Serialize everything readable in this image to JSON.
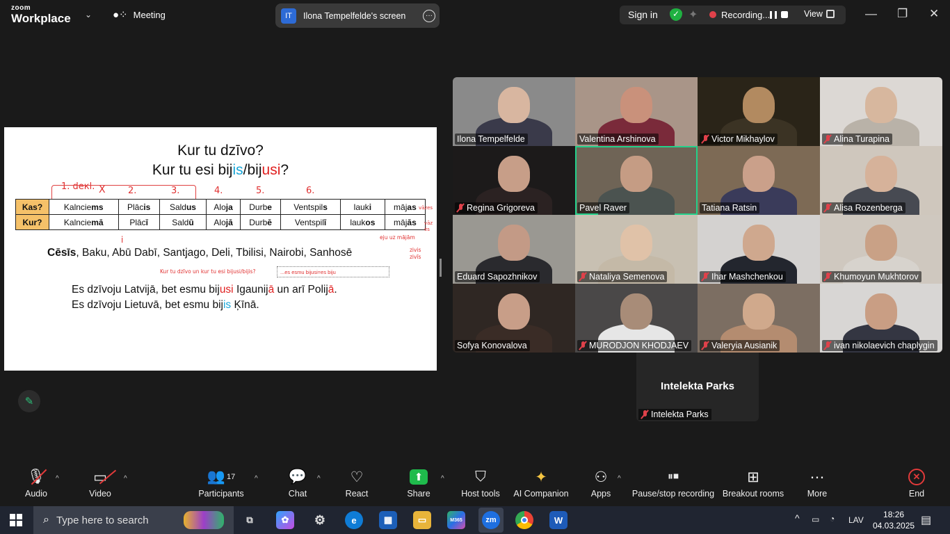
{
  "topbar": {
    "logo_small": "zoom",
    "logo_large": "Workplace",
    "meeting_label": "Meeting",
    "screen_badge": "IT",
    "screen_label": "Ilona Tempelfelde's screen",
    "sign_in": "Sign in",
    "recording_label": "Recording...",
    "view_label": "View"
  },
  "slide": {
    "title1": "Kur tu dzīvo?",
    "title2_a": "Kur tu esi bij",
    "title2_b": "is",
    "title2_c": "/bij",
    "title2_d": "usi",
    "title2_e": "?",
    "row1_head": "Kas?",
    "row2_head": "Kur?",
    "row1": [
      [
        "Kalncie",
        "ms"
      ],
      [
        "Plāc",
        "is"
      ],
      [
        "Sald",
        "us"
      ],
      [
        "Alo",
        "ja"
      ],
      [
        "Durb",
        "e"
      ],
      [
        "Ventspil",
        "s"
      ],
      [
        "lauk",
        "i"
      ],
      [
        "māj",
        "as"
      ]
    ],
    "row2": [
      [
        "Kalncie",
        "mā"
      ],
      [
        "Plāc",
        "ī"
      ],
      [
        "Sald",
        "ū"
      ],
      [
        "Alo",
        "jā"
      ],
      [
        "Durb",
        "ē"
      ],
      [
        "Ventspil",
        "ī"
      ],
      [
        "lauk",
        "os"
      ],
      [
        "māj",
        "ās"
      ]
    ],
    "cities_bold": "Cēsīs",
    "cities_rest": ", Baku, Abū Dabī, Santjago, Deli, Tbilisi, Nairobi, Sanhosē",
    "sentence1": [
      "Es dzīvoju Latvijā, bet esmu bij",
      "usi",
      " Igaunij",
      "ā",
      " un arī Polij",
      "ā",
      "."
    ],
    "sentence2": [
      "Es dzīvoju Lietuvā, bet esmu bij",
      "is",
      " Ķīnā."
    ],
    "annotations": {
      "num1": "1. deкl.",
      "num2": "2.",
      "num3": "3.",
      "num4": "4.",
      "num5": "5.",
      "num6": "6.",
      "cross": "X",
      "small_i": "i",
      "vazes": "vāzes",
      "vaz": "vāz",
      "es": "ēs",
      "eju": "eju uz mājām",
      "zivis1": "zivis",
      "zivis2": "zivīs",
      "question": "Kur tu dzīvo un kur tu esi bijusi/bijis?",
      "textbox": "...es esmu bijusi=es biju"
    }
  },
  "participants": [
    {
      "name": "Ilona Tempelfelde",
      "muted": false,
      "bg": "#8a8a8a",
      "face": "#d8b6a0",
      "body": "#3a3a4a"
    },
    {
      "name": "Valentina Arshinova",
      "muted": false,
      "bg": "#a99588",
      "face": "#c9917b",
      "body": "#7a2a3a"
    },
    {
      "name": "Victor Mikhaylov",
      "muted": true,
      "bg": "#2a2418",
      "face": "#b28a60",
      "body": "#3b3324"
    },
    {
      "name": "Alina Turapina",
      "muted": true,
      "bg": "#dcd8d4",
      "face": "#d7b79e",
      "body": "#b9b2a8"
    },
    {
      "name": "Regina Grigoreva",
      "muted": true,
      "bg": "#1c1a1a",
      "face": "#c79e88",
      "body": "#2b2222"
    },
    {
      "name": "Pavel Raver",
      "muted": false,
      "bg": "#6f6456",
      "face": "#c59c84",
      "body": "#4b5350"
    },
    {
      "name": "Tatiana Ratsin",
      "muted": false,
      "bg": "#7d6a55",
      "face": "#caa08a",
      "body": "#3a3b5a"
    },
    {
      "name": "Alisa Rozenberga",
      "muted": true,
      "bg": "#cfc7bd",
      "face": "#d6b29a",
      "body": "#474a52"
    },
    {
      "name": "Eduard Sapozhnikov",
      "muted": false,
      "bg": "#9a9892",
      "face": "#c39a86",
      "body": "#2a2a2e"
    },
    {
      "name": "Nataliya Semenova",
      "muted": true,
      "bg": "#c8c0b2",
      "face": "#e0c2a8",
      "body": "#c4b9a7"
    },
    {
      "name": "Ihar Mashchenkou",
      "muted": true,
      "bg": "#d4d2d0",
      "face": "#cfa88e",
      "body": "#23262e"
    },
    {
      "name": "Khumoyun Mukhtorov",
      "muted": true,
      "bg": "#cfc8bf",
      "face": "#c9a186",
      "body": "#d7d3cd"
    },
    {
      "name": "Sofya Konovalova",
      "muted": false,
      "bg": "#2f2723",
      "face": "#c89e88",
      "body": "#3a2c26"
    },
    {
      "name": "MURODJON KHODJAEV",
      "muted": true,
      "bg": "#4a4848",
      "face": "#a88c78",
      "body": "#e6e6e6"
    },
    {
      "name": "Valeryia Ausianik",
      "muted": true,
      "bg": "#7c6e62",
      "face": "#d0a98c",
      "body": "#b48c70"
    },
    {
      "name": "ivan nikolaevich chaplygin",
      "muted": true,
      "bg": "#d8d6d4",
      "face": "#c99e84",
      "body": "#343642"
    }
  ],
  "solo": {
    "big_name": "Intelekta Parks",
    "label": "Intelekta Parks"
  },
  "toolbar": {
    "audio": "Audio",
    "video": "Video",
    "participants": "Participants",
    "participants_count": "17",
    "chat": "Chat",
    "react": "React",
    "share": "Share",
    "host_tools": "Host tools",
    "ai_companion": "AI Companion",
    "apps": "Apps",
    "pause_recording": "Pause/stop recording",
    "breakout": "Breakout rooms",
    "more": "More",
    "end": "End"
  },
  "taskbar": {
    "search_placeholder": "Type here to search",
    "lang": "LAV",
    "time": "18:26",
    "date": "04.03.2025"
  }
}
